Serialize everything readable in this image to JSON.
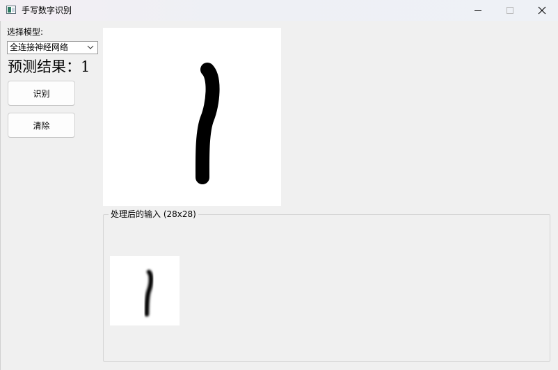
{
  "window": {
    "title": "手写数字识别",
    "icon": "app-window-icon"
  },
  "controls": {
    "model_label": "选择模型:",
    "model_selected": "全连接神经网络",
    "result_label": "预测结果：",
    "result_value": "1",
    "recognize_button": "识别",
    "clear_button": "清除"
  },
  "preview": {
    "group_title": "处理后的输入 (28x28)"
  },
  "colors": {
    "background": "#f0f0f0",
    "canvas": "#ffffff",
    "stroke": "#000000"
  }
}
